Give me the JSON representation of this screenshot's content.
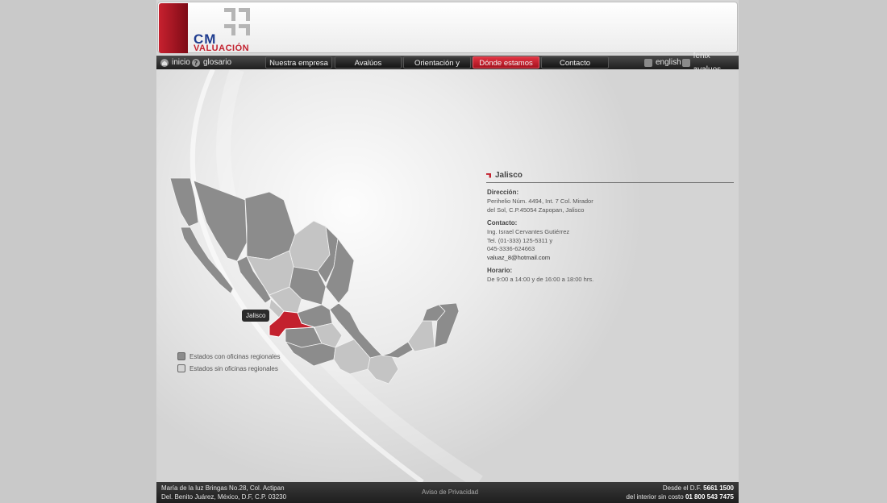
{
  "brand": {
    "logo_line1": "CM",
    "logo_line2": "VALUACIÓN",
    "accent_color": "#c3212e",
    "brand_blue": "#1f3c8f"
  },
  "nav": {
    "left_links": [
      {
        "label": "inicio",
        "icon": "home-icon"
      },
      {
        "label": "glosario",
        "icon": "help-icon"
      }
    ],
    "tabs": [
      {
        "label": "Nuestra empresa",
        "active": false
      },
      {
        "label": "Avalúos",
        "active": false
      },
      {
        "label": "Orientación y ayuda",
        "active": false
      },
      {
        "label": "Dónde estamos",
        "active": true
      },
      {
        "label": "Contacto",
        "active": false
      }
    ],
    "right_links": [
      {
        "label": "english",
        "icon": "speech-bubble-icon"
      },
      {
        "label": "fenix avaluos",
        "icon": "fenix-logo-icon"
      }
    ]
  },
  "map": {
    "tooltip": "Jalisco",
    "selected_state": "Jalisco",
    "colors": {
      "with_office": "#8c8c8c",
      "without_office": "#c4c4c4",
      "selected": "#c3212e"
    },
    "legend": [
      {
        "label": "Estados con oficinas regionales",
        "color": "#8c8c8c"
      },
      {
        "label": "Estados sin oficinas regionales",
        "color": "#d4d4d4"
      }
    ]
  },
  "office": {
    "title": "Jalisco",
    "direccion_label": "Dirección:",
    "direccion_lines": [
      "Perihelio Núm. 4494, Int. 7 Col. Mirador",
      "del Sol, C.P.45054 Zapopan, Jalisco"
    ],
    "contacto_label": "Contacto:",
    "contacto_lines": [
      "Ing. Israel Cervantes Gutiérrez",
      "Tel. (01-333) 125-5311 y",
      "045-3336-624663"
    ],
    "email": "valuaz_8@hotmail.com",
    "horario_label": "Horario:",
    "horario": "De 9:00 a 14:00 y de 16:00 a 18:00 hrs."
  },
  "footer": {
    "address_line1": "María de la luz Bringas No.28, Col. Actipan",
    "address_line2": "Del. Benito Juárez, México, D.F, C.P. 03230",
    "privacy_link": "Aviso de Privacidad",
    "phone_line1_prefix": "Desde el D.F.",
    "phone_line1_number": "5661 1500",
    "phone_line2_prefix": "del interior sin costo",
    "phone_line2_number": "01 800 543 7475"
  }
}
